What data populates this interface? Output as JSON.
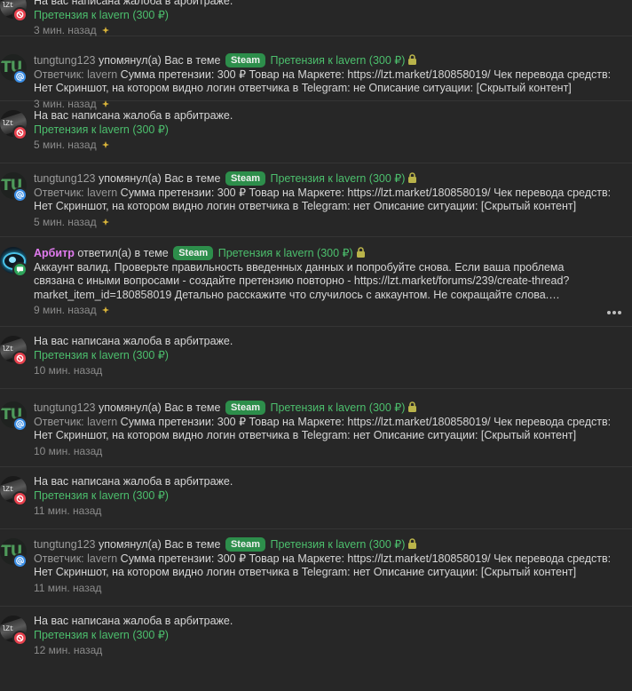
{
  "common": {
    "complaint_text": "На вас написана жалоба в арбитраже.",
    "claim_link": "Претензия к lavern (300 ₽)",
    "mention_text": "упомянул(а) Вас в теме",
    "reply_text": "ответил(а) в теме",
    "steam_label": "Steam",
    "username": "tungtung123",
    "arbiter_name": "Арбитр",
    "respondent_label": "Ответчик:",
    "respondent_name": "lavern",
    "lzt_avatar_text": "lZt",
    "tu_avatar_text": "TU"
  },
  "items": [
    {
      "kind": "complaint",
      "time": "3 мин. назад"
    },
    {
      "kind": "mention",
      "body_rest": "Сумма претензии: 300 ₽ Товар на Маркете: https://lzt.market/180858019/ Чек перевода средств: Нет Скриншот, на котором видно логин ответчика в Telegram: не Описание ситуации: [Скрытый контент]",
      "time": "3 мин. назад"
    },
    {
      "kind": "complaint",
      "time": "5 мин. назад"
    },
    {
      "kind": "mention",
      "body_rest": "Сумма претензии: 300 ₽ Товар на Маркете: https://lzt.market/180858019/ Чек перевода средств: Нет Скриншот, на котором видно логин ответчика в Telegram: нет Описание ситуации: [Скрытый контент]",
      "time": "5 мин. назад"
    },
    {
      "kind": "reply",
      "body": "Аккаунт валид. Проверьте правильность введенных данных и попробуйте снова. Если ваша проблема связана с иными вопросами - создайте претензию повторно - https://lzt.market/forums/239/create-thread?market_item_id=180858019 Детально расскажите что случилось с аккаунтом. Не сокращайте слова. Дополни...",
      "time": "9 мин. назад"
    },
    {
      "kind": "complaint",
      "time": "10 мин. назад"
    },
    {
      "kind": "mention",
      "body_rest": "Сумма претензии: 300 ₽ Товар на Маркете: https://lzt.market/180858019/ Чек перевода средств: Нет Скриншот, на котором видно логин ответчика в Telegram: нет Описание ситуации: [Скрытый контент]",
      "time": "10 мин. назад"
    },
    {
      "kind": "complaint",
      "time": "11 мин. назад"
    },
    {
      "kind": "mention",
      "body_rest": "Сумма претензии: 300 ₽ Товар на Маркете: https://lzt.market/180858019/ Чек перевода средств: Нет Скриншот, на котором видно логин ответчика в Telegram: нет Описание ситуации: [Скрытый контент]",
      "time": "11 мин. назад"
    },
    {
      "kind": "complaint",
      "time": "12 мин. назад"
    }
  ],
  "colors": {
    "background": "#272727",
    "accent_green": "#4cbf6d",
    "steam_badge": "#2d8e4b",
    "arbiter_name": "#e27bf0",
    "badge_red": "#e8414e",
    "badge_blue": "#3a8ee6",
    "badge_green": "#2ea45a"
  },
  "icons": [
    "lock-icon",
    "star-icon",
    "block-icon",
    "at-icon",
    "chat-icon",
    "more-icon"
  ]
}
